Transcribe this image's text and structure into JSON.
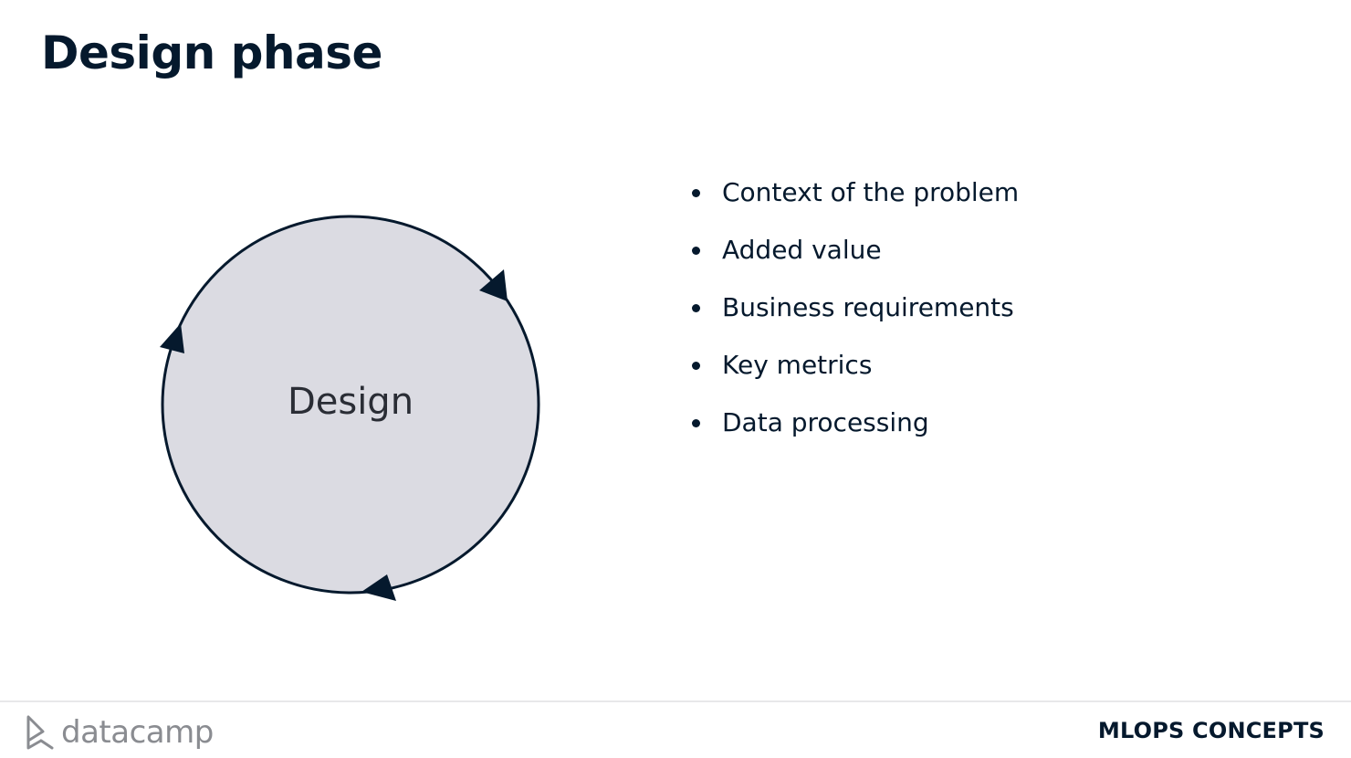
{
  "slide": {
    "title": "Design phase"
  },
  "diagram": {
    "label": "Design",
    "fill_color": "#dbdbe2",
    "stroke_color": "#05192d"
  },
  "bullets": [
    "Context of the problem",
    "Added value",
    "Business requirements",
    "Key metrics",
    "Data processing"
  ],
  "footer": {
    "logo_text": "datacamp",
    "logo_icon": "datacamp-logo-icon",
    "course_name": "MLOPS CONCEPTS"
  }
}
